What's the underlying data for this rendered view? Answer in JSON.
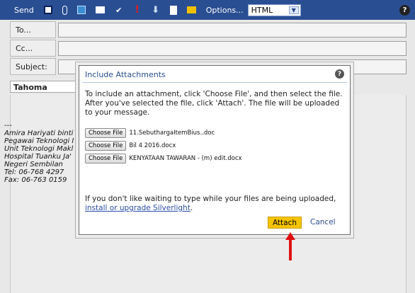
{
  "toolbar": {
    "send_label": "Send",
    "options_label": "Options...",
    "format_value": "HTML",
    "help_glyph": "?"
  },
  "compose": {
    "to_label": "To...",
    "cc_label": "Cc...",
    "subject_label": "Subject:",
    "font_value": "Tahoma"
  },
  "signature": {
    "lines": [
      "---",
      "Amira Hariyati binti",
      "Pegawai Teknologi M",
      "Unit Teknologi Makl",
      "Hospital Tuanku Ja'",
      "Negeri Sembilan",
      "Tel: 06-768 4297",
      "Fax: 06-763 0159"
    ]
  },
  "dialog": {
    "title": "Include Attachments",
    "help_glyph": "?",
    "message": "To include an attachment, click 'Choose File', and then select the file. After you've selected the file, click 'Attach'. The file will be uploaded to your message.",
    "choose_label": "Choose File",
    "files": [
      "11.SebuthargaItemBius..doc",
      "Bil 4 2016.docx",
      "KENYATAAN TAWARAN - (m) edit.docx"
    ],
    "footer_text": "If you don't like waiting to type while your files are being uploaded, ",
    "footer_link": "install or upgrade Silverlight",
    "footer_end": ".",
    "attach_label": "Attach",
    "cancel_label": "Cancel"
  },
  "colors": {
    "toolbar_bg": "#2a4e92",
    "attach_bg": "#f7c400",
    "arrow": "#e01010"
  }
}
